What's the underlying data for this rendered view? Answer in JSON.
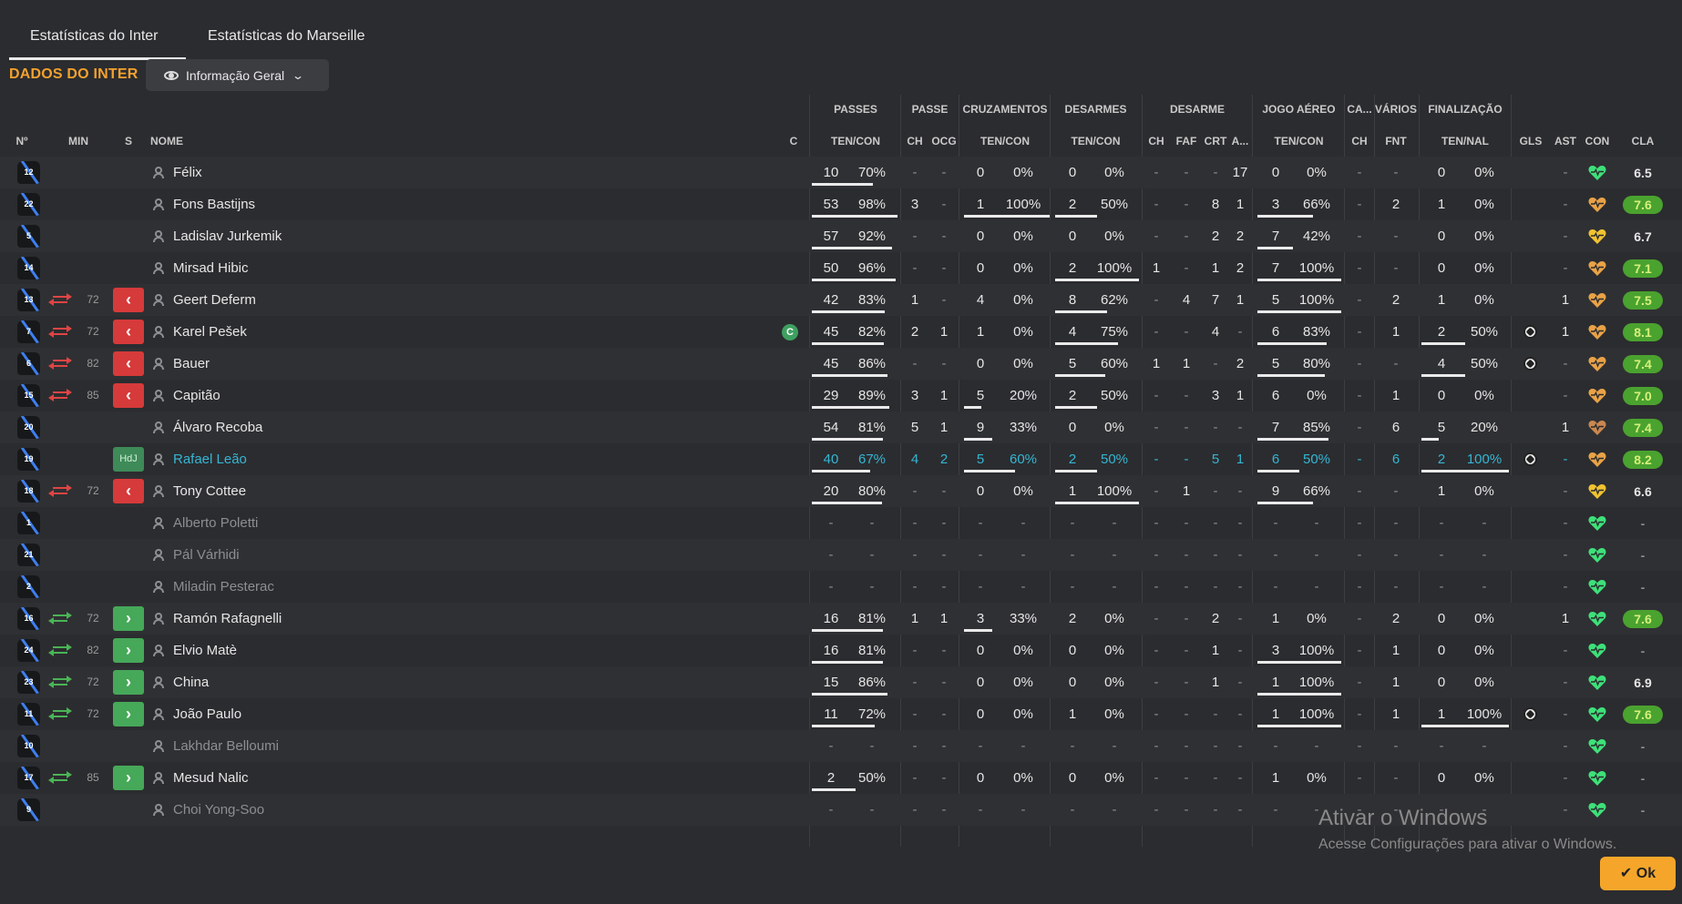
{
  "tabs": [
    "Estatísticas do Inter",
    "Estatísticas do Marseille"
  ],
  "section_title": "DADOS DO INTER",
  "view_select": {
    "label": "Informação Geral"
  },
  "group_headers": {
    "passes": "PASSES",
    "passe": "PASSE",
    "cruzamentos": "CRUZAMENTOS",
    "desarmes": "DESARMES",
    "desarme": "DESARME",
    "jogo_aereo": "JOGO AÉREO",
    "ca": "CA...",
    "varios": "VÁRIOS",
    "finalizacao": "FINALIZAÇÃO"
  },
  "column_headers": {
    "num": "Nº",
    "min": "MIN",
    "s": "S",
    "nome": "NOME",
    "c": "C",
    "passes_tencon": "TEN/CON",
    "passe_ch": "CH",
    "passe_ocg": "OCG",
    "cruz_tencon": "TEN/CON",
    "desarmes_tencon": "TEN/CON",
    "desarme_ch": "CH",
    "desarme_faf": "FAF",
    "desarme_crt": "CRT",
    "desarme_a": "A...",
    "aereo_tencon": "TEN/CON",
    "ca_ch": "CH",
    "varios_fnt": "FNT",
    "fin_tennal": "TEN/NAL",
    "gls": "GLS",
    "ast": "AST",
    "con": "CON",
    "cla": "CLA"
  },
  "players": [
    {
      "num": "12",
      "min": "",
      "sub": "",
      "name": "Félix",
      "pc": "10",
      "pp": "70%",
      "pch": "-",
      "pocg": "-",
      "cc": "0",
      "cp": "0%",
      "dc": "0",
      "dp": "0%",
      "dch": "-",
      "faf": "-",
      "crt": "-",
      "da": "17",
      "ac": "0",
      "ap": "0%",
      "ca": "-",
      "fnt": "-",
      "fc": "0",
      "fp": "0%",
      "gls": "",
      "ast": "-",
      "con": "green",
      "cla": "6.5"
    },
    {
      "num": "22",
      "min": "",
      "sub": "",
      "name": "Fons Bastijns",
      "pc": "53",
      "pp": "98%",
      "pch": "3",
      "pocg": "-",
      "cc": "1",
      "cp": "100%",
      "dc": "2",
      "dp": "50%",
      "dch": "-",
      "faf": "-",
      "crt": "8",
      "da": "1",
      "ac": "3",
      "ap": "66%",
      "ca": "-",
      "fnt": "2",
      "fc": "1",
      "fp": "0%",
      "gls": "",
      "ast": "-",
      "con": "orange",
      "cla": "7.6"
    },
    {
      "num": "5",
      "min": "",
      "sub": "",
      "name": "Ladislav Jurkemik",
      "pc": "57",
      "pp": "92%",
      "pch": "-",
      "pocg": "-",
      "cc": "0",
      "cp": "0%",
      "dc": "0",
      "dp": "0%",
      "dch": "-",
      "faf": "-",
      "crt": "2",
      "da": "2",
      "ac": "7",
      "ap": "42%",
      "ca": "-",
      "fnt": "-",
      "fc": "0",
      "fp": "0%",
      "gls": "",
      "ast": "-",
      "con": "yellow",
      "cla": "6.7"
    },
    {
      "num": "14",
      "min": "",
      "sub": "",
      "name": "Mirsad Hibic",
      "pc": "50",
      "pp": "96%",
      "pch": "-",
      "pocg": "-",
      "cc": "0",
      "cp": "0%",
      "dc": "2",
      "dp": "100%",
      "dch": "1",
      "faf": "-",
      "crt": "1",
      "da": "2",
      "ac": "7",
      "ap": "100%",
      "ca": "-",
      "fnt": "-",
      "fc": "0",
      "fp": "0%",
      "gls": "",
      "ast": "-",
      "con": "orange",
      "cla": "7.1"
    },
    {
      "num": "13",
      "min": "72",
      "sub": "off",
      "name": "Geert Deferm",
      "pc": "42",
      "pp": "83%",
      "pch": "1",
      "pocg": "-",
      "cc": "4",
      "cp": "0%",
      "dc": "8",
      "dp": "62%",
      "dch": "-",
      "faf": "4",
      "crt": "7",
      "da": "1",
      "ac": "5",
      "ap": "100%",
      "ca": "-",
      "fnt": "2",
      "fc": "1",
      "fp": "0%",
      "gls": "",
      "ast": "1",
      "con": "orange",
      "cla": "7.5"
    },
    {
      "num": "7",
      "min": "72",
      "sub": "off",
      "name": "Karel Pešek",
      "pc": "45",
      "pp": "82%",
      "pch": "2",
      "pocg": "1",
      "cc": "1",
      "cp": "0%",
      "dc": "4",
      "dp": "75%",
      "dch": "-",
      "faf": "-",
      "crt": "4",
      "da": "-",
      "ac": "6",
      "ap": "83%",
      "ca": "-",
      "fnt": "1",
      "fc": "2",
      "fp": "50%",
      "gls": "ball",
      "ast": "1",
      "con": "orange",
      "cla": "8.1",
      "captain": "C"
    },
    {
      "num": "6",
      "min": "82",
      "sub": "off",
      "name": "Bauer",
      "pc": "45",
      "pp": "86%",
      "pch": "-",
      "pocg": "-",
      "cc": "0",
      "cp": "0%",
      "dc": "5",
      "dp": "60%",
      "dch": "1",
      "faf": "1",
      "crt": "-",
      "da": "2",
      "ac": "5",
      "ap": "80%",
      "ca": "-",
      "fnt": "-",
      "fc": "4",
      "fp": "50%",
      "gls": "ball",
      "ast": "-",
      "con": "orange",
      "cla": "7.4"
    },
    {
      "num": "15",
      "min": "85",
      "sub": "off",
      "name": "Capitão",
      "pc": "29",
      "pp": "89%",
      "pch": "3",
      "pocg": "1",
      "cc": "5",
      "cp": "20%",
      "dc": "2",
      "dp": "50%",
      "dch": "-",
      "faf": "-",
      "crt": "3",
      "da": "1",
      "ac": "6",
      "ap": "0%",
      "ca": "-",
      "fnt": "1",
      "fc": "0",
      "fp": "0%",
      "gls": "",
      "ast": "-",
      "con": "orange",
      "cla": "7.0"
    },
    {
      "num": "20",
      "min": "",
      "sub": "",
      "name": "Álvaro Recoba",
      "pc": "54",
      "pp": "81%",
      "pch": "5",
      "pocg": "1",
      "cc": "9",
      "cp": "33%",
      "dc": "0",
      "dp": "0%",
      "dch": "-",
      "faf": "-",
      "crt": "-",
      "da": "-",
      "ac": "7",
      "ap": "85%",
      "ca": "-",
      "fnt": "6",
      "fc": "5",
      "fp": "20%",
      "gls": "",
      "ast": "1",
      "con": "brown",
      "cla": "7.4"
    },
    {
      "num": "19",
      "min": "",
      "sub": "potm",
      "potm_label": "HdJ",
      "name": "Rafael Leão",
      "pc": "40",
      "pp": "67%",
      "pch": "4",
      "pocg": "2",
      "cc": "5",
      "cp": "60%",
      "dc": "2",
      "dp": "50%",
      "dch": "-",
      "faf": "-",
      "crt": "5",
      "da": "1",
      "ac": "6",
      "ap": "50%",
      "ca": "-",
      "fnt": "6",
      "fc": "2",
      "fp": "100%",
      "gls": "ball",
      "ast": "-",
      "con": "orange",
      "cla": "8.2",
      "highlight": true
    },
    {
      "num": "18",
      "min": "72",
      "sub": "off",
      "name": "Tony Cottee",
      "pc": "20",
      "pp": "80%",
      "pch": "-",
      "pocg": "-",
      "cc": "0",
      "cp": "0%",
      "dc": "1",
      "dp": "100%",
      "dch": "-",
      "faf": "1",
      "crt": "-",
      "da": "-",
      "ac": "9",
      "ap": "66%",
      "ca": "-",
      "fnt": "-",
      "fc": "1",
      "fp": "0%",
      "gls": "",
      "ast": "-",
      "con": "yellow",
      "cla": "6.6"
    },
    {
      "num": "1",
      "min": "",
      "sub": "",
      "name": "Alberto Poletti",
      "pc": "-",
      "pp": "-",
      "pch": "-",
      "pocg": "-",
      "cc": "-",
      "cp": "-",
      "dc": "-",
      "dp": "-",
      "dch": "-",
      "faf": "-",
      "crt": "-",
      "da": "-",
      "ac": "-",
      "ap": "-",
      "ca": "-",
      "fnt": "-",
      "fc": "-",
      "fp": "-",
      "gls": "",
      "ast": "-",
      "con": "green",
      "cla": "-",
      "unused": true
    },
    {
      "num": "21",
      "min": "",
      "sub": "",
      "name": "Pál Várhidi",
      "pc": "-",
      "pp": "-",
      "pch": "-",
      "pocg": "-",
      "cc": "-",
      "cp": "-",
      "dc": "-",
      "dp": "-",
      "dch": "-",
      "faf": "-",
      "crt": "-",
      "da": "-",
      "ac": "-",
      "ap": "-",
      "ca": "-",
      "fnt": "-",
      "fc": "-",
      "fp": "-",
      "gls": "",
      "ast": "-",
      "con": "green",
      "cla": "-",
      "unused": true
    },
    {
      "num": "2",
      "min": "",
      "sub": "",
      "name": "Miladin Pesterac",
      "pc": "-",
      "pp": "-",
      "pch": "-",
      "pocg": "-",
      "cc": "-",
      "cp": "-",
      "dc": "-",
      "dp": "-",
      "dch": "-",
      "faf": "-",
      "crt": "-",
      "da": "-",
      "ac": "-",
      "ap": "-",
      "ca": "-",
      "fnt": "-",
      "fc": "-",
      "fp": "-",
      "gls": "",
      "ast": "-",
      "con": "green",
      "cla": "-",
      "unused": true
    },
    {
      "num": "16",
      "min": "72",
      "sub": "on",
      "name": "Ramón Rafagnelli",
      "pc": "16",
      "pp": "81%",
      "pch": "1",
      "pocg": "1",
      "cc": "3",
      "cp": "33%",
      "dc": "2",
      "dp": "0%",
      "dch": "-",
      "faf": "-",
      "crt": "2",
      "da": "-",
      "ac": "1",
      "ap": "0%",
      "ca": "-",
      "fnt": "2",
      "fc": "0",
      "fp": "0%",
      "gls": "",
      "ast": "1",
      "con": "green",
      "cla": "7.6"
    },
    {
      "num": "24",
      "min": "82",
      "sub": "on",
      "name": "Elvio Matè",
      "pc": "16",
      "pp": "81%",
      "pch": "-",
      "pocg": "-",
      "cc": "0",
      "cp": "0%",
      "dc": "0",
      "dp": "0%",
      "dch": "-",
      "faf": "-",
      "crt": "1",
      "da": "-",
      "ac": "3",
      "ap": "100%",
      "ca": "-",
      "fnt": "1",
      "fc": "0",
      "fp": "0%",
      "gls": "",
      "ast": "-",
      "con": "green",
      "cla": "-"
    },
    {
      "num": "23",
      "min": "72",
      "sub": "on",
      "name": "China",
      "pc": "15",
      "pp": "86%",
      "pch": "-",
      "pocg": "-",
      "cc": "0",
      "cp": "0%",
      "dc": "0",
      "dp": "0%",
      "dch": "-",
      "faf": "-",
      "crt": "1",
      "da": "-",
      "ac": "1",
      "ap": "100%",
      "ca": "-",
      "fnt": "1",
      "fc": "0",
      "fp": "0%",
      "gls": "",
      "ast": "-",
      "con": "green",
      "cla": "6.9"
    },
    {
      "num": "11",
      "min": "72",
      "sub": "on",
      "name": "João Paulo",
      "pc": "11",
      "pp": "72%",
      "pch": "-",
      "pocg": "-",
      "cc": "0",
      "cp": "0%",
      "dc": "1",
      "dp": "0%",
      "dch": "-",
      "faf": "-",
      "crt": "-",
      "da": "-",
      "ac": "1",
      "ap": "100%",
      "ca": "-",
      "fnt": "1",
      "fc": "1",
      "fp": "100%",
      "gls": "ball",
      "ast": "-",
      "con": "green",
      "cla": "7.6"
    },
    {
      "num": "10",
      "min": "",
      "sub": "",
      "name": "Lakhdar Belloumi",
      "pc": "-",
      "pp": "-",
      "pch": "-",
      "pocg": "-",
      "cc": "-",
      "cp": "-",
      "dc": "-",
      "dp": "-",
      "dch": "-",
      "faf": "-",
      "crt": "-",
      "da": "-",
      "ac": "-",
      "ap": "-",
      "ca": "-",
      "fnt": "-",
      "fc": "-",
      "fp": "-",
      "gls": "",
      "ast": "-",
      "con": "green",
      "cla": "-",
      "unused": true
    },
    {
      "num": "17",
      "min": "85",
      "sub": "on",
      "name": "Mesud Nalic",
      "pc": "2",
      "pp": "50%",
      "pch": "-",
      "pocg": "-",
      "cc": "0",
      "cp": "0%",
      "dc": "0",
      "dp": "0%",
      "dch": "-",
      "faf": "-",
      "crt": "-",
      "da": "-",
      "ac": "1",
      "ap": "0%",
      "ca": "-",
      "fnt": "-",
      "fc": "0",
      "fp": "0%",
      "gls": "",
      "ast": "-",
      "con": "green",
      "cla": "-"
    },
    {
      "num": "9",
      "min": "",
      "sub": "",
      "name": "Choi Yong-Soo",
      "pc": "-",
      "pp": "-",
      "pch": "-",
      "pocg": "-",
      "cc": "-",
      "cp": "-",
      "dc": "-",
      "dp": "-",
      "dch": "-",
      "faf": "-",
      "crt": "-",
      "da": "-",
      "ac": "-",
      "ap": "-",
      "ca": "-",
      "fnt": "-",
      "fc": "-",
      "fp": "-",
      "gls": "",
      "ast": "-",
      "con": "green",
      "cla": "-",
      "unused": true
    }
  ],
  "con_colors": {
    "green": "#3ee07a",
    "orange": "#e8a247",
    "yellow": "#f0c232",
    "brown": "#c98850"
  },
  "colors": {
    "accent": "#f3a22e",
    "highlight": "#35b6d4",
    "rating_good": "#4aa22f"
  },
  "watermark": {
    "line1": "Ativar o Windows",
    "line2": "Acesse Configurações para ativar o Windows."
  },
  "ok_button": {
    "label": "Ok"
  }
}
